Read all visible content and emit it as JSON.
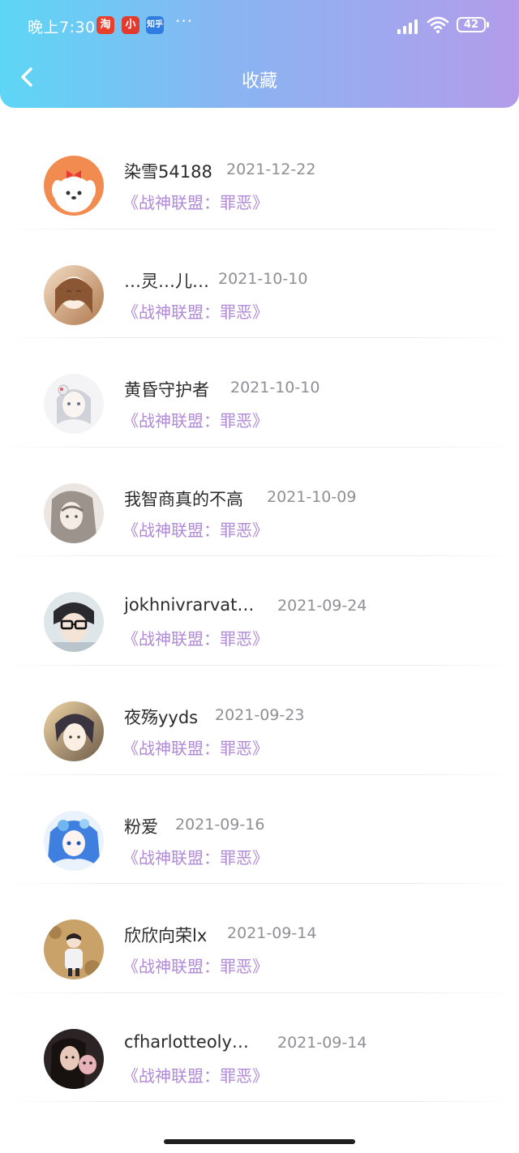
{
  "status_bar": {
    "time": "晚上7:30",
    "apps": [
      "淘",
      "小",
      "知乎"
    ],
    "more": "···",
    "battery": "42"
  },
  "header": {
    "title": "收藏"
  },
  "favorites": [
    {
      "user": "染雪54188",
      "date": "2021-12-22",
      "work": "《战神联盟：罪恶》"
    },
    {
      "user": "…灵…儿…",
      "date": "2021-10-10",
      "work": "《战神联盟：罪恶》"
    },
    {
      "user": "黄昏守护者",
      "date": "2021-10-10",
      "work": "《战神联盟：罪恶》"
    },
    {
      "user": "我智商真的不高",
      "date": "2021-10-09",
      "work": "《战神联盟：罪恶》"
    },
    {
      "user": "jokhnivrarvat…",
      "date": "2021-09-24",
      "work": "《战神联盟：罪恶》"
    },
    {
      "user": "夜殇yyds",
      "date": "2021-09-23",
      "work": "《战神联盟：罪恶》"
    },
    {
      "user": "粉爱",
      "date": "2021-09-16",
      "work": "《战神联盟：罪恶》"
    },
    {
      "user": "欣欣向荣lx",
      "date": "2021-09-14",
      "work": "《战神联盟：罪恶》"
    },
    {
      "user": "cfharlotteoly…",
      "date": "2021-09-14",
      "work": "《战神联盟：罪恶》"
    }
  ],
  "icons": {
    "back": "chevron-left-icon",
    "signal": "signal-icon",
    "wifi": "wifi-icon",
    "battery": "battery-icon"
  },
  "colors": {
    "header_gradient_start": "#5dd6f5",
    "header_gradient_end": "#b39cea",
    "work_title": "#b08ad6",
    "date_text": "#8f8f95",
    "name_text": "#2b2b2b"
  }
}
